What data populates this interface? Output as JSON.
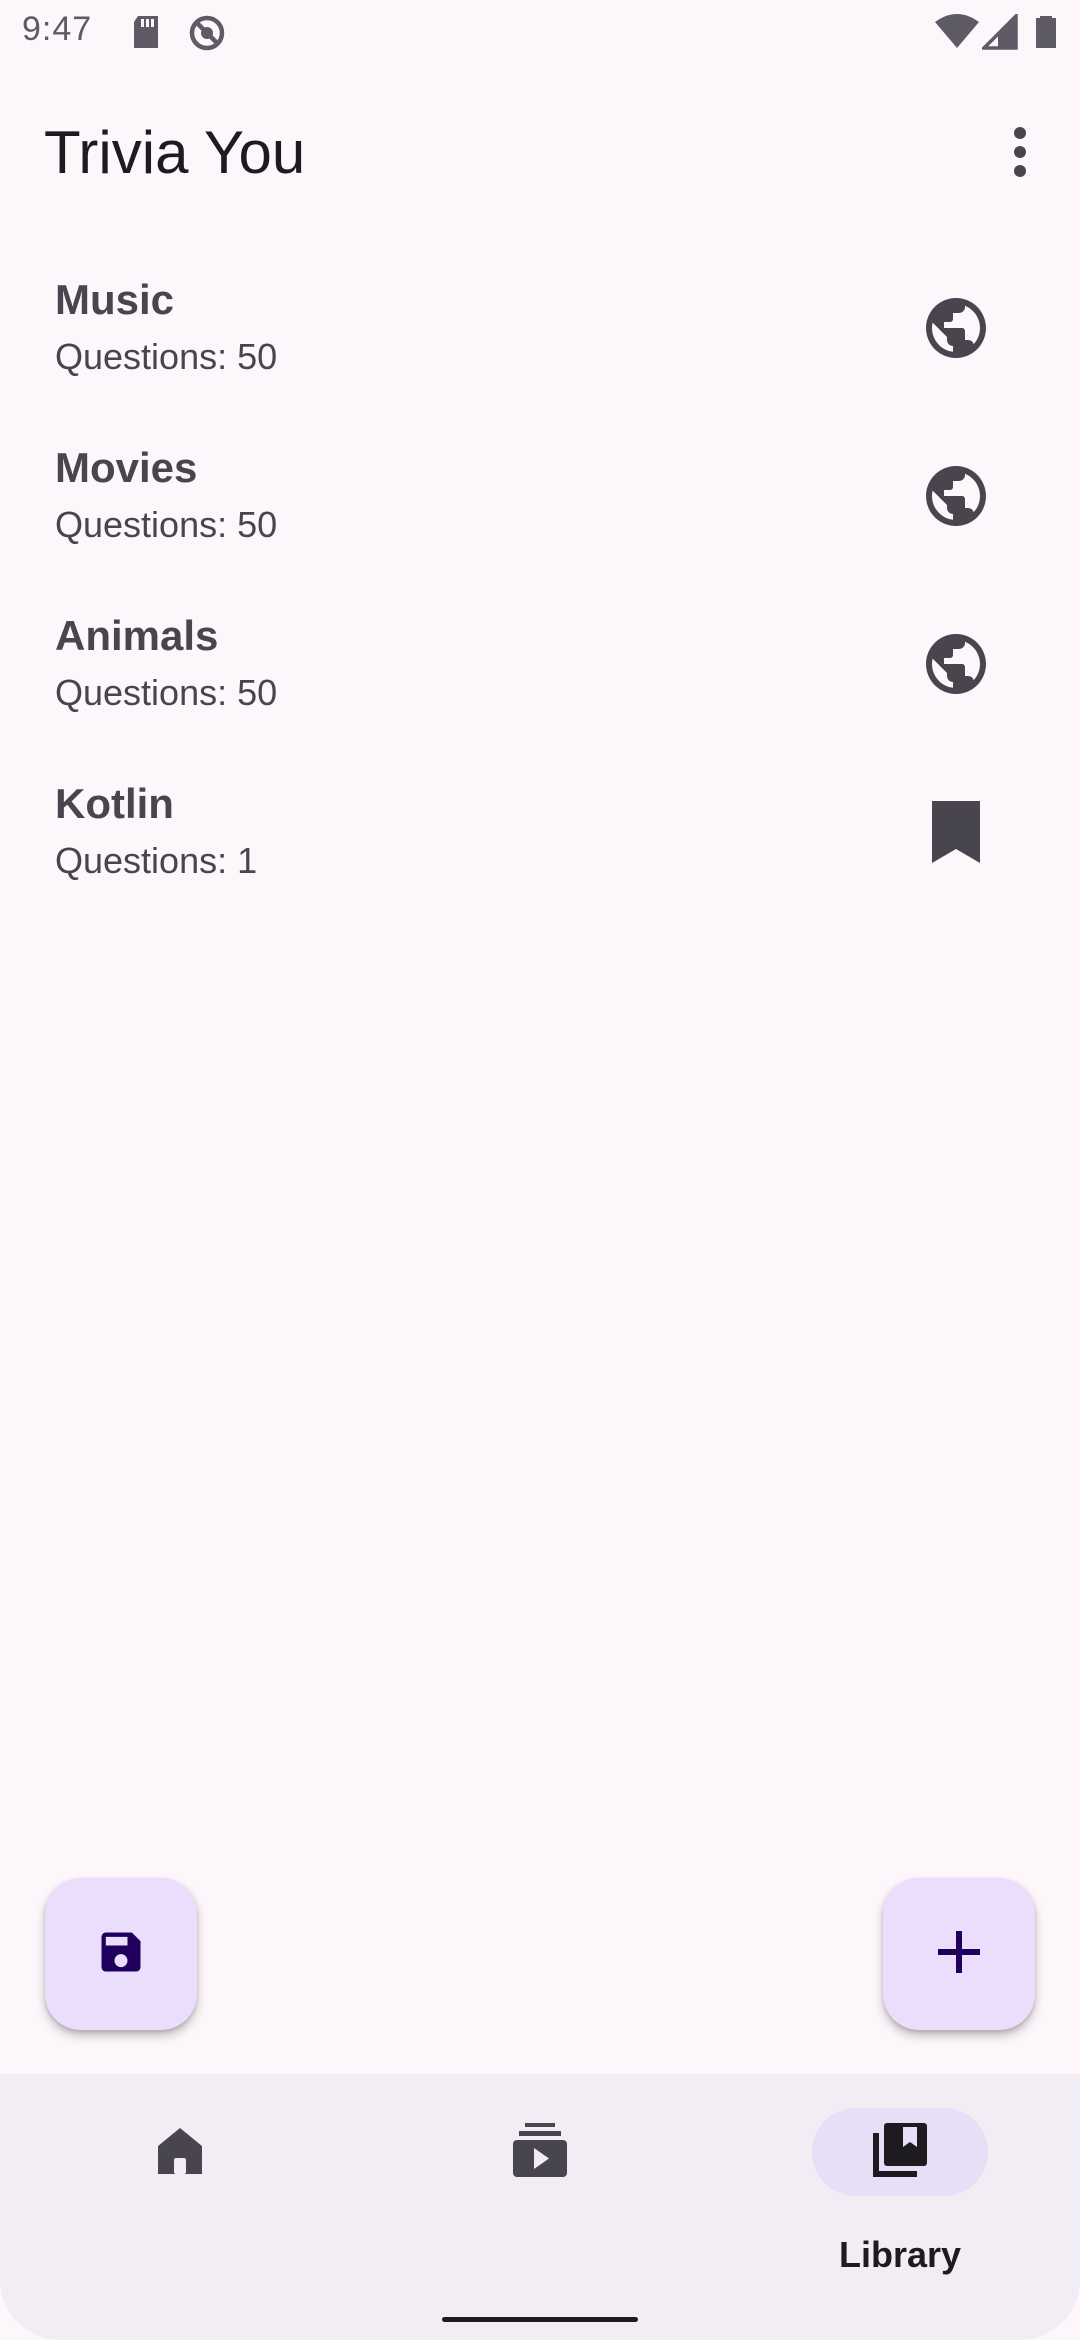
{
  "status_bar": {
    "time": "9:47",
    "icons": [
      "sd-card-icon",
      "sync-disabled-icon",
      "wifi-icon",
      "signal-icon",
      "battery-icon"
    ]
  },
  "app_bar": {
    "title": "Trivia You",
    "menu_icon": "more-vert-icon"
  },
  "quizzes": [
    {
      "title": "Music",
      "subtitle": "Questions: 50",
      "icon": "globe-icon"
    },
    {
      "title": "Movies",
      "subtitle": "Questions: 50",
      "icon": "globe-icon"
    },
    {
      "title": "Animals",
      "subtitle": "Questions: 50",
      "icon": "globe-icon"
    },
    {
      "title": "Kotlin",
      "subtitle": "Questions: 1",
      "icon": "bookmark-icon"
    }
  ],
  "fabs": {
    "save_icon": "save-icon",
    "add_icon": "add-icon"
  },
  "bottom_nav": {
    "items": [
      {
        "icon": "home-icon",
        "label": ""
      },
      {
        "icon": "play-stack-icon",
        "label": ""
      },
      {
        "icon": "library-icon",
        "label": "Library",
        "active": true
      }
    ]
  },
  "colors": {
    "background": "#fdf7fb",
    "fab_container": "#ebdefc",
    "nav_background": "#f2edf5",
    "nav_active_indicator": "#e8def8",
    "icon_dark": "#49454f",
    "fab_icon": "#21005d"
  }
}
